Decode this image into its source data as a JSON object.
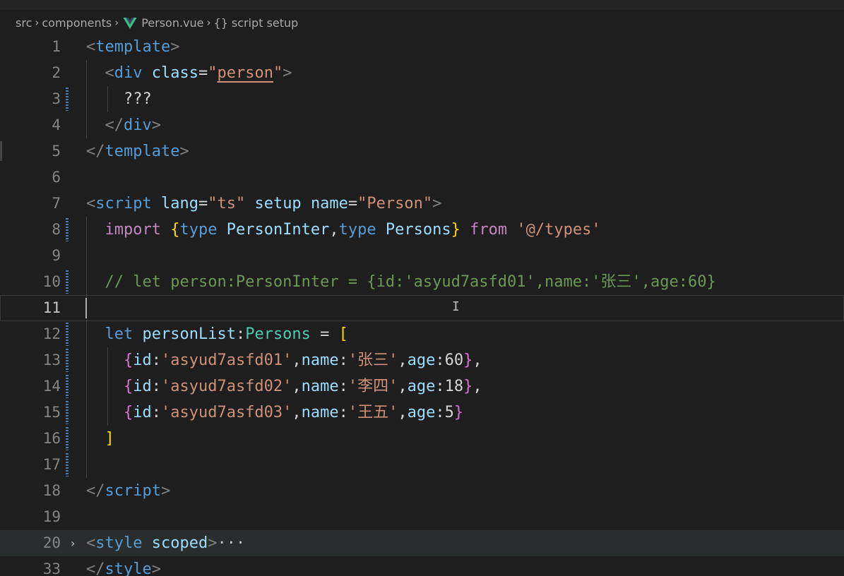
{
  "breadcrumb": {
    "items": [
      "src",
      "components",
      "Person.vue",
      "script setup"
    ],
    "symbol_glyph": "{}"
  },
  "editor": {
    "folded_ellipsis": "···",
    "lines": [
      {
        "num": "1",
        "tokens": [
          [
            "t-br",
            "<"
          ],
          [
            "t-tag",
            "template"
          ],
          [
            "t-br",
            ">"
          ]
        ]
      },
      {
        "num": "2",
        "tokens": [
          [
            "t-txt",
            "  "
          ],
          [
            "t-br",
            "<"
          ],
          [
            "t-tag",
            "div"
          ],
          [
            "t-txt",
            " "
          ],
          [
            "t-attr",
            "class"
          ],
          [
            "t-txt",
            "="
          ],
          [
            "t-str",
            "\""
          ],
          [
            "t-str-u",
            "person"
          ],
          [
            "t-str",
            "\""
          ],
          [
            "t-br",
            ">"
          ]
        ]
      },
      {
        "num": "3",
        "tokens": [
          [
            "t-txt",
            "    ???"
          ]
        ]
      },
      {
        "num": "4",
        "tokens": [
          [
            "t-txt",
            "  "
          ],
          [
            "t-br",
            "</"
          ],
          [
            "t-tag",
            "div"
          ],
          [
            "t-br",
            ">"
          ]
        ]
      },
      {
        "num": "5",
        "tokens": [
          [
            "t-br",
            "</"
          ],
          [
            "t-tag",
            "template"
          ],
          [
            "t-br",
            ">"
          ]
        ]
      },
      {
        "num": "6",
        "tokens": []
      },
      {
        "num": "7",
        "tokens": [
          [
            "t-br",
            "<"
          ],
          [
            "t-tag",
            "script"
          ],
          [
            "t-txt",
            " "
          ],
          [
            "t-attr",
            "lang"
          ],
          [
            "t-txt",
            "="
          ],
          [
            "t-str",
            "\"ts\""
          ],
          [
            "t-txt",
            " "
          ],
          [
            "t-attr",
            "setup"
          ],
          [
            "t-txt",
            " "
          ],
          [
            "t-attr",
            "name"
          ],
          [
            "t-txt",
            "="
          ],
          [
            "t-str",
            "\"Person\""
          ],
          [
            "t-br",
            ">"
          ]
        ]
      },
      {
        "num": "8",
        "tokens": [
          [
            "t-txt",
            "  "
          ],
          [
            "t-kw2",
            "import"
          ],
          [
            "t-txt",
            " "
          ],
          [
            "t-b1",
            "{"
          ],
          [
            "t-kw",
            "type"
          ],
          [
            "t-txt",
            " "
          ],
          [
            "t-var",
            "PersonInter"
          ],
          [
            "t-txt",
            ","
          ],
          [
            "t-kw",
            "type"
          ],
          [
            "t-txt",
            " "
          ],
          [
            "t-var",
            "Persons"
          ],
          [
            "t-b1",
            "}"
          ],
          [
            "t-txt",
            " "
          ],
          [
            "t-kw2",
            "from"
          ],
          [
            "t-txt",
            " "
          ],
          [
            "t-str",
            "'@/types'"
          ]
        ]
      },
      {
        "num": "9",
        "tokens": []
      },
      {
        "num": "10",
        "tokens": [
          [
            "t-txt",
            "  "
          ],
          [
            "t-cm",
            "// let person:PersonInter = {id:'asyud7asfd01',name:'张三',age:60}"
          ]
        ]
      },
      {
        "num": "11",
        "tokens": []
      },
      {
        "num": "12",
        "tokens": [
          [
            "t-txt",
            "  "
          ],
          [
            "t-kw",
            "let"
          ],
          [
            "t-txt",
            " "
          ],
          [
            "t-var",
            "personList"
          ],
          [
            "t-txt",
            ":"
          ],
          [
            "t-type",
            "Persons"
          ],
          [
            "t-txt",
            " = "
          ],
          [
            "t-b1",
            "["
          ]
        ]
      },
      {
        "num": "13",
        "tokens": [
          [
            "t-txt",
            "    "
          ],
          [
            "t-b2",
            "{"
          ],
          [
            "t-var",
            "id"
          ],
          [
            "t-txt",
            ":"
          ],
          [
            "t-str",
            "'asyud7asfd01'"
          ],
          [
            "t-txt",
            ","
          ],
          [
            "t-var",
            "name"
          ],
          [
            "t-txt",
            ":"
          ],
          [
            "t-str",
            "'张三'"
          ],
          [
            "t-txt",
            ","
          ],
          [
            "t-var",
            "age"
          ],
          [
            "t-txt",
            ":"
          ],
          [
            "t-txt",
            "60"
          ],
          [
            "t-b2",
            "}"
          ],
          [
            "t-txt",
            ","
          ]
        ]
      },
      {
        "num": "14",
        "tokens": [
          [
            "t-txt",
            "    "
          ],
          [
            "t-b2",
            "{"
          ],
          [
            "t-var",
            "id"
          ],
          [
            "t-txt",
            ":"
          ],
          [
            "t-str",
            "'asyud7asfd02'"
          ],
          [
            "t-txt",
            ","
          ],
          [
            "t-var",
            "name"
          ],
          [
            "t-txt",
            ":"
          ],
          [
            "t-str",
            "'李四'"
          ],
          [
            "t-txt",
            ","
          ],
          [
            "t-var",
            "age"
          ],
          [
            "t-txt",
            ":"
          ],
          [
            "t-txt",
            "18"
          ],
          [
            "t-b2",
            "}"
          ],
          [
            "t-txt",
            ","
          ]
        ]
      },
      {
        "num": "15",
        "tokens": [
          [
            "t-txt",
            "    "
          ],
          [
            "t-b2",
            "{"
          ],
          [
            "t-var",
            "id"
          ],
          [
            "t-txt",
            ":"
          ],
          [
            "t-str",
            "'asyud7asfd03'"
          ],
          [
            "t-txt",
            ","
          ],
          [
            "t-var",
            "name"
          ],
          [
            "t-txt",
            ":"
          ],
          [
            "t-str",
            "'王五'"
          ],
          [
            "t-txt",
            ","
          ],
          [
            "t-var",
            "age"
          ],
          [
            "t-txt",
            ":"
          ],
          [
            "t-txt",
            "5"
          ],
          [
            "t-b2",
            "}"
          ]
        ]
      },
      {
        "num": "16",
        "tokens": [
          [
            "t-txt",
            "  "
          ],
          [
            "t-b1",
            "]"
          ]
        ]
      },
      {
        "num": "17",
        "tokens": []
      },
      {
        "num": "18",
        "tokens": [
          [
            "t-br",
            "</"
          ],
          [
            "t-tag",
            "script"
          ],
          [
            "t-br",
            ">"
          ]
        ]
      },
      {
        "num": "19",
        "tokens": []
      },
      {
        "num": "20",
        "tokens": [
          [
            "t-br",
            "<"
          ],
          [
            "t-tag",
            "style"
          ],
          [
            "t-txt",
            " "
          ],
          [
            "t-attr",
            "scoped"
          ],
          [
            "t-br",
            ">"
          ]
        ]
      },
      {
        "num": "33",
        "tokens": [
          [
            "t-br",
            "</"
          ],
          [
            "t-tag",
            "style"
          ],
          [
            "t-br",
            ">"
          ]
        ]
      }
    ]
  }
}
